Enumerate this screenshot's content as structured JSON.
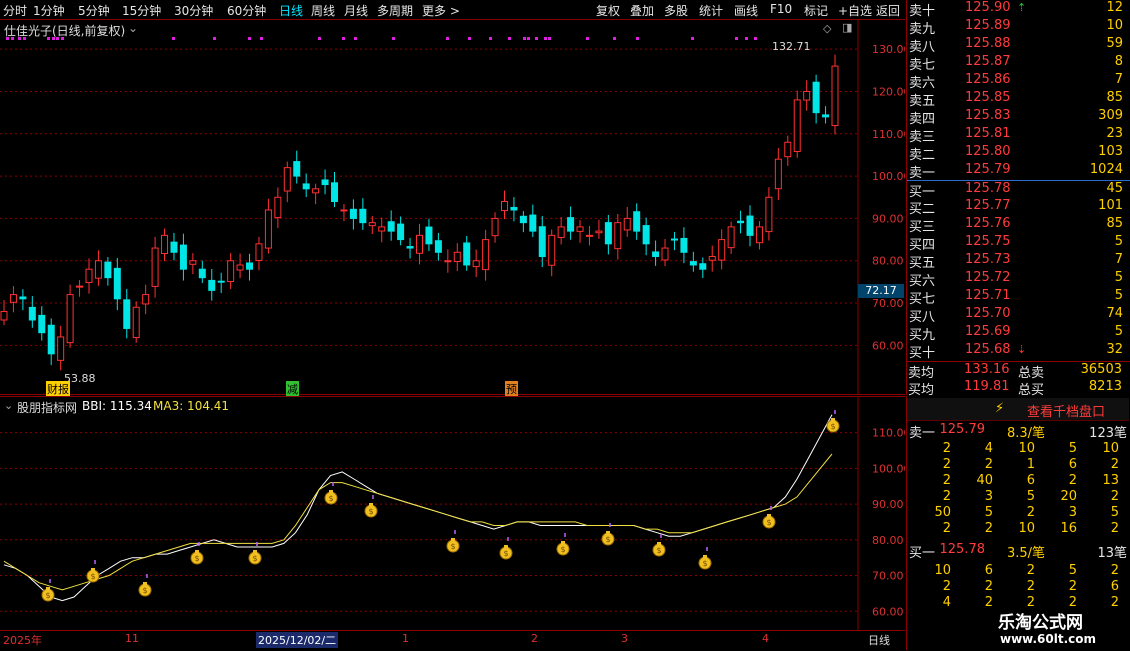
{
  "toolbar": {
    "tabs": [
      "分时",
      "1分钟",
      "5分钟",
      "15分钟",
      "30分钟",
      "60分钟",
      "日线",
      "周线",
      "月线",
      "多周期",
      "更多 >"
    ],
    "active_tab": "日线",
    "tools": [
      "复权",
      "叠加",
      "多股",
      "统计",
      "画线",
      "F10",
      "标记",
      "+自选",
      "返回"
    ]
  },
  "main_chart": {
    "title": "仕佳光子(日线,前复权)",
    "high_label": "132.71",
    "low_label": "53.88",
    "current_price_tag": "72.17",
    "events": [
      "财报",
      "减",
      "预"
    ]
  },
  "sub_chart": {
    "title": "股朋指标网",
    "bbi_label": "BBI: 115.34",
    "ma3_label": "MA3: 104.41"
  },
  "time_axis": {
    "labels": [
      "2025年",
      "11",
      "2025/12/02/二",
      "1",
      "2",
      "3",
      "4"
    ],
    "period": "日线"
  },
  "order_book": {
    "asks": [
      {
        "label": "卖十",
        "price": "125.90",
        "vol": "12"
      },
      {
        "label": "卖九",
        "price": "125.89",
        "vol": "10"
      },
      {
        "label": "卖八",
        "price": "125.88",
        "vol": "59"
      },
      {
        "label": "卖七",
        "price": "125.87",
        "vol": "8"
      },
      {
        "label": "卖六",
        "price": "125.86",
        "vol": "7"
      },
      {
        "label": "卖五",
        "price": "125.85",
        "vol": "85"
      },
      {
        "label": "卖四",
        "price": "125.83",
        "vol": "309"
      },
      {
        "label": "卖三",
        "price": "125.81",
        "vol": "23"
      },
      {
        "label": "卖二",
        "price": "125.80",
        "vol": "103"
      },
      {
        "label": "卖一",
        "price": "125.79",
        "vol": "1024"
      }
    ],
    "bids": [
      {
        "label": "买一",
        "price": "125.78",
        "vol": "45"
      },
      {
        "label": "买二",
        "price": "125.77",
        "vol": "101"
      },
      {
        "label": "买三",
        "price": "125.76",
        "vol": "85"
      },
      {
        "label": "买四",
        "price": "125.75",
        "vol": "5"
      },
      {
        "label": "买五",
        "price": "125.73",
        "vol": "7"
      },
      {
        "label": "买六",
        "price": "125.72",
        "vol": "5"
      },
      {
        "label": "买七",
        "price": "125.71",
        "vol": "5"
      },
      {
        "label": "买八",
        "price": "125.70",
        "vol": "74"
      },
      {
        "label": "买九",
        "price": "125.69",
        "vol": "5"
      },
      {
        "label": "买十",
        "price": "125.68",
        "vol": "32"
      }
    ],
    "summary": {
      "ask_avg_label": "卖均",
      "ask_avg": "133.16",
      "ask_total_label": "总卖",
      "ask_total": "36503",
      "bid_avg_label": "买均",
      "bid_avg": "119.81",
      "bid_total_label": "总买",
      "bid_total": "8213"
    }
  },
  "deal_panel": {
    "button": "查看千档盘口",
    "ask1": {
      "label": "卖一",
      "price": "125.79",
      "avg": "8.3/笔",
      "count": "123笔"
    },
    "ask_rows": [
      [
        "2",
        "4",
        "10",
        "5",
        "10"
      ],
      [
        "2",
        "2",
        "1",
        "6",
        "2"
      ],
      [
        "2",
        "40",
        "6",
        "2",
        "13"
      ],
      [
        "2",
        "3",
        "5",
        "20",
        "2"
      ],
      [
        "50",
        "5",
        "2",
        "3",
        "5"
      ],
      [
        "2",
        "2",
        "10",
        "16",
        "2"
      ]
    ],
    "bid1": {
      "label": "买一",
      "price": "125.78",
      "avg": "3.5/笔",
      "count": "13笔"
    },
    "bid_rows": [
      [
        "10",
        "6",
        "2",
        "5",
        "2"
      ],
      [
        "2",
        "2",
        "2",
        "2",
        "6"
      ],
      [
        "4",
        "2",
        "2",
        "2",
        "2"
      ]
    ]
  },
  "watermark": {
    "line1": "乐淘公式网",
    "line2": "www.60lt.com"
  },
  "colors": {
    "up": "#ff3030",
    "down": "#00e5e5",
    "bbi": "#ffffff",
    "ma3": "#f0e040",
    "grid": "#8b0000",
    "accent": "#ffd000"
  },
  "chart_data": [
    {
      "type": "candlestick",
      "title": "仕佳光子(日线,前复权)",
      "ylim": [
        53,
        135
      ],
      "yticks": [
        60,
        70,
        80,
        90,
        100,
        110,
        120,
        130
      ],
      "series": [
        {
          "name": "close",
          "values": [
            68,
            72,
            71,
            66,
            63,
            58,
            62,
            72,
            74,
            78,
            80,
            76,
            71,
            64,
            69,
            72,
            83,
            86,
            82,
            78,
            80,
            76,
            73,
            75,
            80,
            79,
            78,
            84,
            92,
            95,
            102,
            100,
            97,
            97,
            98,
            94,
            92,
            90,
            89,
            89,
            88,
            87,
            85,
            83,
            86,
            84,
            82,
            80,
            82,
            79,
            80,
            85,
            90,
            94,
            92,
            89,
            87,
            81,
            86,
            88,
            87,
            88,
            86,
            87,
            84,
            89,
            90,
            87,
            84,
            81,
            83,
            85,
            82,
            79,
            78,
            81,
            85,
            88,
            89,
            86,
            88,
            95,
            104,
            108,
            118,
            120,
            115,
            114,
            126
          ]
        }
      ]
    },
    {
      "type": "line",
      "title": "股朋指标网",
      "ylim": [
        57,
        118
      ],
      "yticks": [
        60,
        70,
        80,
        90,
        100,
        110
      ],
      "series": [
        {
          "name": "BBI",
          "values": [
            73,
            72,
            70,
            67,
            64,
            63,
            64,
            67,
            70,
            72,
            74,
            75,
            75,
            76,
            76,
            77,
            78,
            79,
            80,
            79,
            78,
            78,
            78,
            78,
            79,
            82,
            87,
            94,
            98,
            99,
            97,
            95,
            93,
            92,
            91,
            90,
            89,
            88,
            87,
            86,
            85,
            84,
            83,
            84,
            85,
            85,
            84,
            84,
            84,
            84,
            84,
            84,
            84,
            84,
            84,
            83,
            82,
            81,
            81,
            82,
            83,
            84,
            85,
            86,
            87,
            88,
            89,
            92,
            97,
            103,
            109,
            115
          ]
        },
        {
          "name": "MA3",
          "values": [
            74,
            72,
            70,
            68,
            67,
            66,
            67,
            68,
            69,
            70,
            72,
            74,
            75,
            76,
            77,
            78,
            79,
            79,
            79,
            79,
            79,
            79,
            79,
            79,
            80,
            84,
            89,
            94,
            96,
            96,
            95,
            94,
            93,
            92,
            91,
            90,
            89,
            88,
            87,
            86,
            85,
            85,
            84,
            84,
            85,
            85,
            85,
            85,
            85,
            85,
            84,
            84,
            84,
            84,
            84,
            83,
            83,
            82,
            82,
            82,
            83,
            84,
            85,
            86,
            87,
            88,
            89,
            90,
            92,
            96,
            100,
            104
          ]
        }
      ]
    }
  ]
}
